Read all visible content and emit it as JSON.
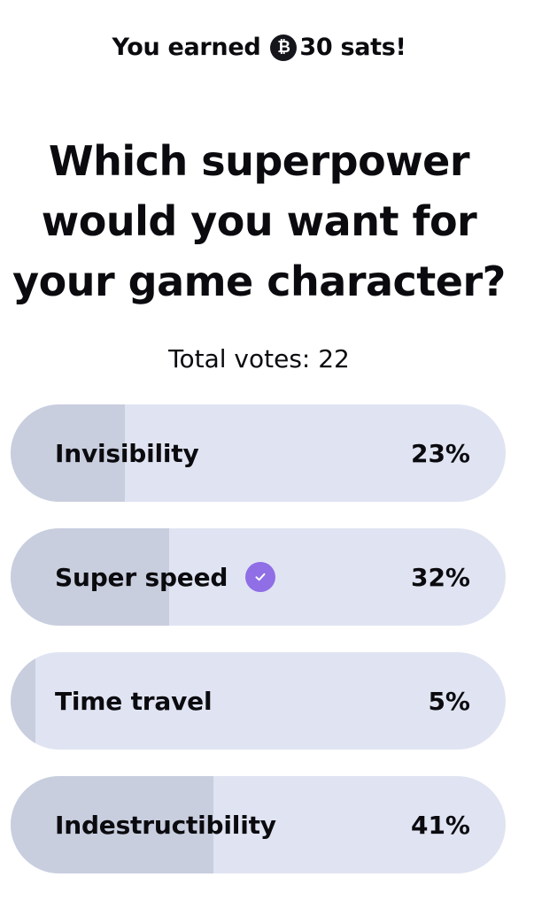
{
  "header": {
    "prefix": "You earned",
    "coin_icon": "bitcoin-coin-icon",
    "coin_symbol": "₿",
    "suffix": "30 sats!"
  },
  "poll": {
    "question": "Which superpower would you want for your game character?",
    "total_votes": "Total votes: 22",
    "options": [
      {
        "label": "Invisibility",
        "percent_text": "23%",
        "percent": 23,
        "selected": false
      },
      {
        "label": "Super speed",
        "percent_text": "32%",
        "percent": 32,
        "selected": true,
        "selected_icon": "check-circle-icon"
      },
      {
        "label": "Time travel",
        "percent_text": "5%",
        "percent": 5,
        "selected": false
      },
      {
        "label": "Indestructibility",
        "percent_text": "41%",
        "percent": 41,
        "selected": false
      }
    ]
  },
  "colors": {
    "track": "#e0e4f2",
    "fill": "#c8cede",
    "check": "#8f6ee6",
    "coin": "#15151c"
  }
}
